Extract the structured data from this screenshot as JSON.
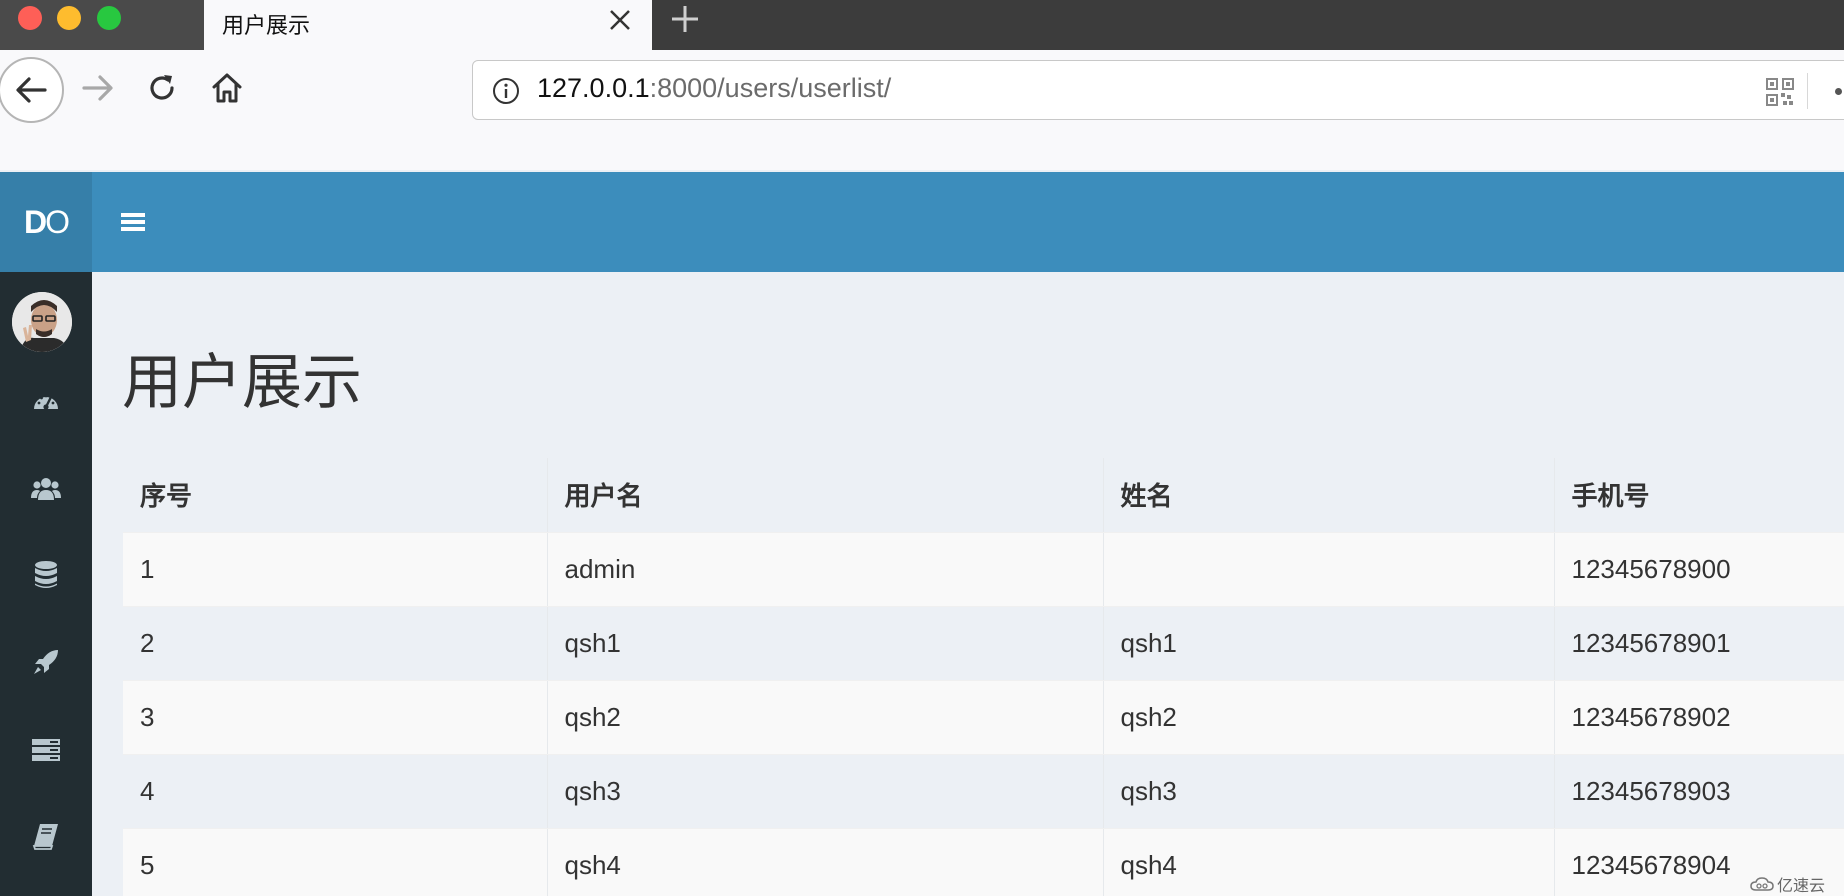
{
  "browser": {
    "tab_title": "用户展示",
    "url_host": "127.0.0.1",
    "url_rest": ":8000/users/userlist/"
  },
  "app": {
    "logo_bold": "D",
    "logo_light": "O",
    "header_color": "#3c8dbc",
    "sidebar_color": "#222d32"
  },
  "sidebar": {
    "icons": [
      "dashboard-icon",
      "users-icon",
      "database-icon",
      "rocket-icon",
      "server-icon",
      "book-icon"
    ]
  },
  "page": {
    "title": "用户展示"
  },
  "table": {
    "headers": [
      "序号",
      "用户名",
      "姓名",
      "手机号"
    ],
    "rows": [
      [
        "1",
        "admin",
        "",
        "12345678900"
      ],
      [
        "2",
        "qsh1",
        "qsh1",
        "12345678901"
      ],
      [
        "3",
        "qsh2",
        "qsh2",
        "12345678902"
      ],
      [
        "4",
        "qsh3",
        "qsh3",
        "12345678903"
      ],
      [
        "5",
        "qsh4",
        "qsh4",
        "12345678904"
      ]
    ]
  },
  "watermark": "亿速云"
}
